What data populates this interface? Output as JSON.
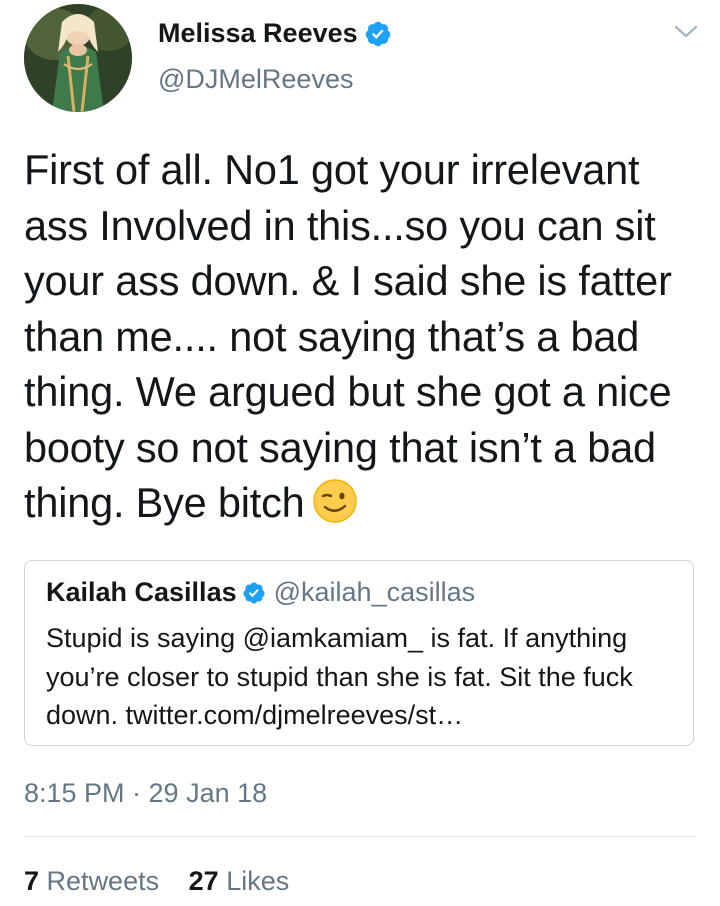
{
  "author": {
    "display_name": "Melissa Reeves",
    "handle": "@DJMelReeves",
    "verified": true,
    "avatar": "profile-photo"
  },
  "tweet": {
    "text": "First of all. No1 got your irrelevant ass Involved in this...so you can sit your ass down. & I said she is fatter than me.... not saying that’s a bad thing. We argued but she got a nice booty so not saying that isn’t a bad thing. Bye bitch",
    "emoji": "winking-face-emoji"
  },
  "quoted_tweet": {
    "display_name": "Kailah Casillas",
    "handle": "@kailah_casillas",
    "verified": true,
    "text": "Stupid is saying @iamkamiam_ is fat. If anything you’re closer to stupid than she is fat. Sit the fuck down. twitter.com/djmelreeves/st…"
  },
  "meta": {
    "timestamp": "8:15 PM · 29 Jan 18"
  },
  "stats": {
    "retweets_count": "7",
    "retweets_label": "Retweets",
    "likes_count": "27",
    "likes_label": "Likes"
  },
  "colors": {
    "verified_blue": "#1da1f2",
    "secondary_text": "#657786",
    "primary_text": "#14171a",
    "border": "#ccd6dd"
  }
}
